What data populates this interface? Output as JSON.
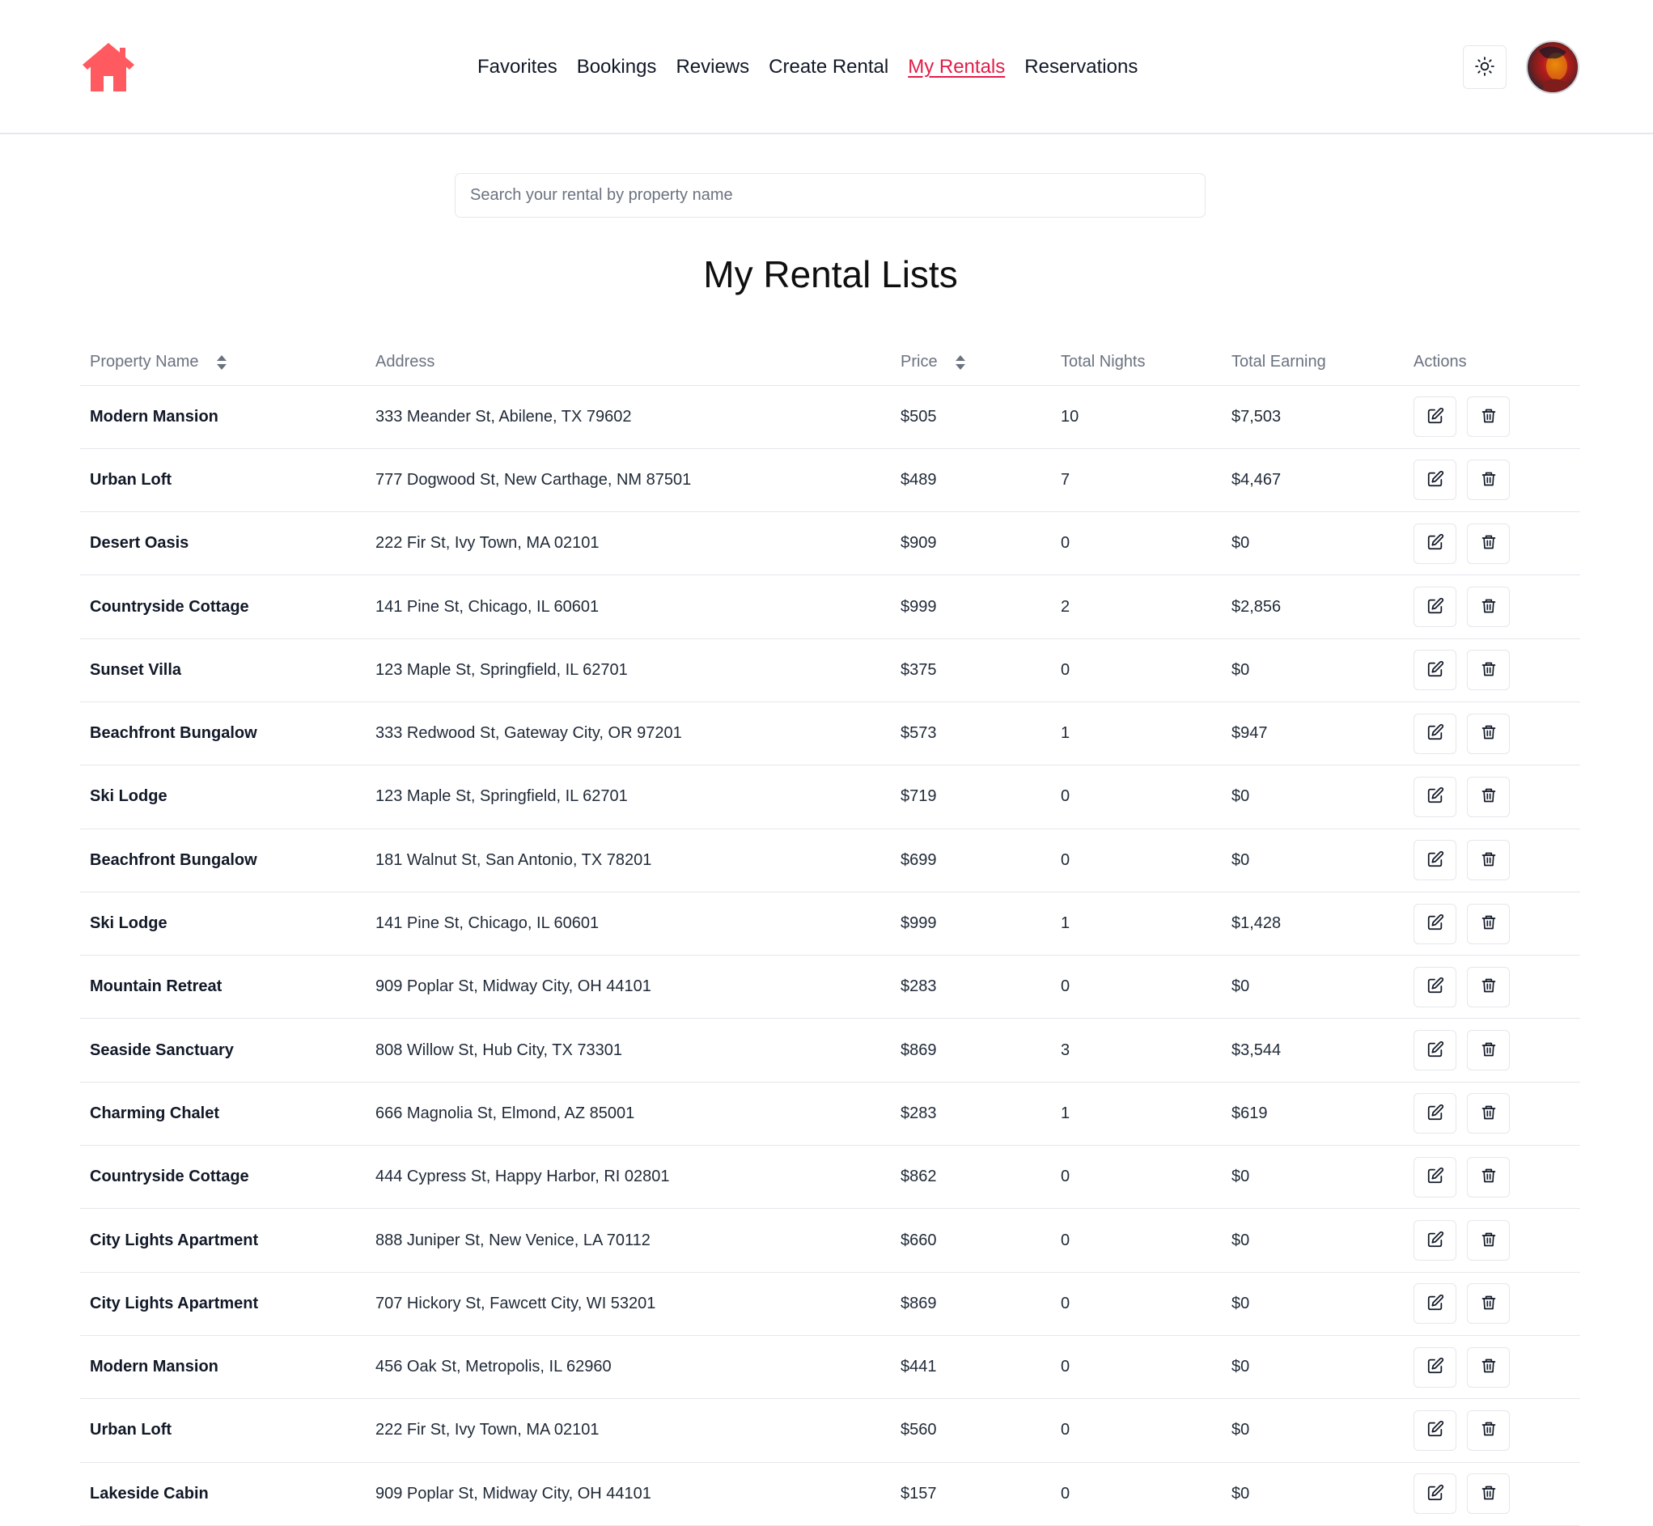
{
  "nav": {
    "links": [
      {
        "label": "Favorites",
        "active": false
      },
      {
        "label": "Bookings",
        "active": false
      },
      {
        "label": "Reviews",
        "active": false
      },
      {
        "label": "Create Rental",
        "active": false
      },
      {
        "label": "My Rentals",
        "active": true
      },
      {
        "label": "Reservations",
        "active": false
      }
    ],
    "brand_color": "#ff5a5f",
    "active_color": "#e11d48"
  },
  "search": {
    "placeholder": "Search your rental by property name",
    "value": ""
  },
  "page": {
    "title": "My Rental Lists"
  },
  "table": {
    "columns": [
      "Property Name",
      "Address",
      "Price",
      "Total Nights",
      "Total Earning",
      "Actions"
    ],
    "sortable": [
      true,
      false,
      true,
      false,
      false,
      false
    ],
    "rows": [
      {
        "name": "Modern Mansion",
        "address": "333 Meander St, Abilene, TX 79602",
        "price": "$505",
        "nights": "10",
        "earning": "$7,503"
      },
      {
        "name": "Urban Loft",
        "address": "777 Dogwood St, New Carthage, NM 87501",
        "price": "$489",
        "nights": "7",
        "earning": "$4,467"
      },
      {
        "name": "Desert Oasis",
        "address": "222 Fir St, Ivy Town, MA 02101",
        "price": "$909",
        "nights": "0",
        "earning": "$0"
      },
      {
        "name": "Countryside Cottage",
        "address": "141 Pine St, Chicago, IL 60601",
        "price": "$999",
        "nights": "2",
        "earning": "$2,856"
      },
      {
        "name": "Sunset Villa",
        "address": "123 Maple St, Springfield, IL 62701",
        "price": "$375",
        "nights": "0",
        "earning": "$0"
      },
      {
        "name": "Beachfront Bungalow",
        "address": "333 Redwood St, Gateway City, OR 97201",
        "price": "$573",
        "nights": "1",
        "earning": "$947"
      },
      {
        "name": "Ski Lodge",
        "address": "123 Maple St, Springfield, IL 62701",
        "price": "$719",
        "nights": "0",
        "earning": "$0"
      },
      {
        "name": "Beachfront Bungalow",
        "address": "181 Walnut St, San Antonio, TX 78201",
        "price": "$699",
        "nights": "0",
        "earning": "$0"
      },
      {
        "name": "Ski Lodge",
        "address": "141 Pine St, Chicago, IL 60601",
        "price": "$999",
        "nights": "1",
        "earning": "$1,428"
      },
      {
        "name": "Mountain Retreat",
        "address": "909 Poplar St, Midway City, OH 44101",
        "price": "$283",
        "nights": "0",
        "earning": "$0"
      },
      {
        "name": "Seaside Sanctuary",
        "address": "808 Willow St, Hub City, TX 73301",
        "price": "$869",
        "nights": "3",
        "earning": "$3,544"
      },
      {
        "name": "Charming Chalet",
        "address": "666 Magnolia St, Elmond, AZ 85001",
        "price": "$283",
        "nights": "1",
        "earning": "$619"
      },
      {
        "name": "Countryside Cottage",
        "address": "444 Cypress St, Happy Harbor, RI 02801",
        "price": "$862",
        "nights": "0",
        "earning": "$0"
      },
      {
        "name": "City Lights Apartment",
        "address": "888 Juniper St, New Venice, LA 70112",
        "price": "$660",
        "nights": "0",
        "earning": "$0"
      },
      {
        "name": "City Lights Apartment",
        "address": "707 Hickory St, Fawcett City, WI 53201",
        "price": "$869",
        "nights": "0",
        "earning": "$0"
      },
      {
        "name": "Modern Mansion",
        "address": "456 Oak St, Metropolis, IL 62960",
        "price": "$441",
        "nights": "0",
        "earning": "$0"
      },
      {
        "name": "Urban Loft",
        "address": "222 Fir St, Ivy Town, MA 02101",
        "price": "$560",
        "nights": "0",
        "earning": "$0"
      },
      {
        "name": "Lakeside Cabin",
        "address": "909 Poplar St, Midway City, OH 44101",
        "price": "$157",
        "nights": "0",
        "earning": "$0"
      }
    ]
  },
  "icons": {
    "logo": "house-icon",
    "theme": "sun-icon",
    "sort": "sort-icon",
    "edit": "edit-icon",
    "delete": "trash-icon"
  }
}
